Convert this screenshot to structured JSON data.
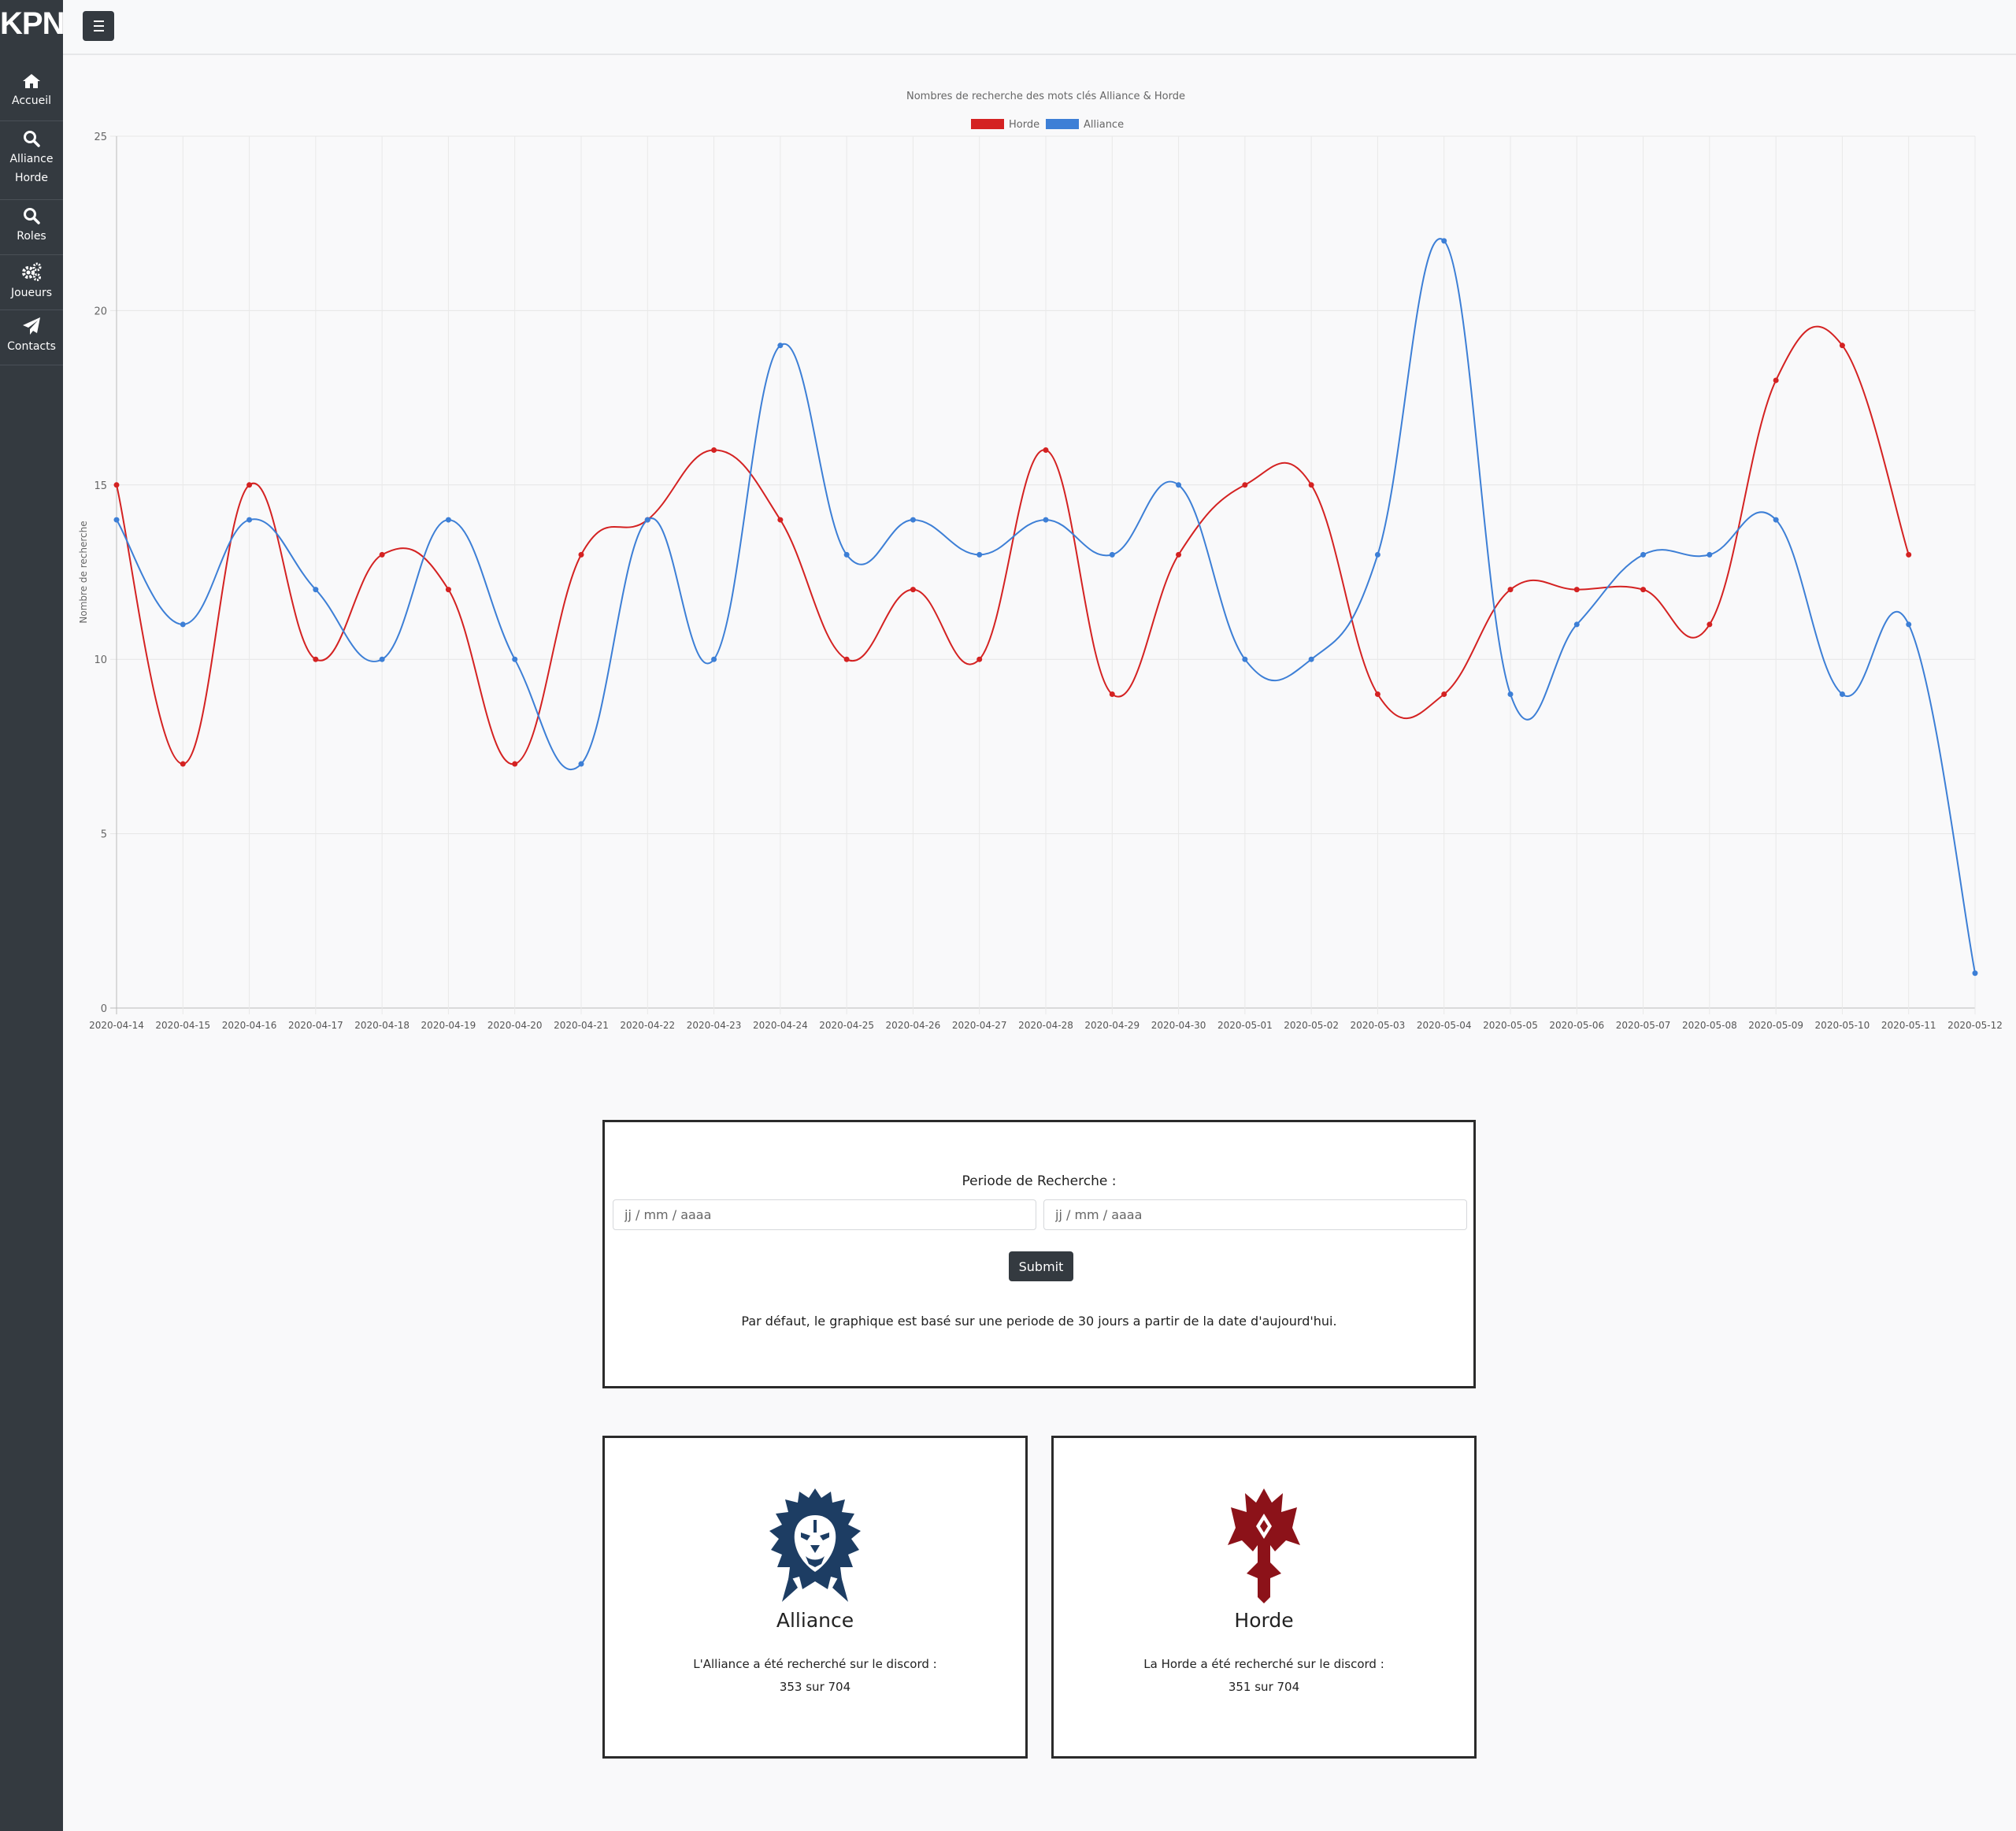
{
  "brand": "KPN",
  "sidebar": {
    "items": [
      {
        "icon": "home-icon",
        "label": "Accueil"
      },
      {
        "icon": "search-icon",
        "label": "Alliance Horde"
      },
      {
        "icon": "search-icon",
        "label": "Roles"
      },
      {
        "icon": "gears-icon",
        "label": "Joueurs"
      },
      {
        "icon": "paper-plane-icon",
        "label": "Contacts"
      }
    ]
  },
  "topbar": {
    "menu_icon": "hamburger-icon"
  },
  "chart_data": {
    "type": "line",
    "title": "Nombres de recherche des mots clés Alliance & Horde",
    "ylabel": "Nombre de recherche",
    "xlabel": "",
    "ylim": [
      0,
      25
    ],
    "yticks": [
      0,
      5,
      10,
      15,
      20,
      25
    ],
    "grid": true,
    "legend_position": "top",
    "categories": [
      "2020-04-14",
      "2020-04-15",
      "2020-04-16",
      "2020-04-17",
      "2020-04-18",
      "2020-04-19",
      "2020-04-20",
      "2020-04-21",
      "2020-04-22",
      "2020-04-23",
      "2020-04-24",
      "2020-04-25",
      "2020-04-26",
      "2020-04-27",
      "2020-04-28",
      "2020-04-29",
      "2020-04-30",
      "2020-05-01",
      "2020-05-02",
      "2020-05-03",
      "2020-05-04",
      "2020-05-05",
      "2020-05-06",
      "2020-05-07",
      "2020-05-08",
      "2020-05-09",
      "2020-05-10",
      "2020-05-11",
      "2020-05-12"
    ],
    "series": [
      {
        "name": "Horde",
        "color": "#d42222",
        "values": [
          15,
          7,
          15,
          10,
          13,
          12,
          7,
          13,
          14,
          16,
          14,
          10,
          12,
          10,
          16,
          9,
          13,
          15,
          15,
          9,
          9,
          12,
          12,
          12,
          11,
          18,
          19,
          13,
          null
        ]
      },
      {
        "name": "Alliance",
        "color": "#3d7fd6",
        "values": [
          14,
          11,
          14,
          12,
          10,
          14,
          10,
          7,
          14,
          10,
          19,
          13,
          14,
          13,
          14,
          13,
          15,
          10,
          10,
          13,
          22,
          9,
          11,
          13,
          13,
          14,
          9,
          11,
          1
        ]
      }
    ]
  },
  "period_form": {
    "label": "Periode de Recherche :",
    "start_placeholder": "jj / mm / aaaa",
    "end_placeholder": "jj / mm / aaaa",
    "submit_label": "Submit",
    "note": "Par défaut, le graphique est basé sur une periode de 30 jours a partir de la date d'aujourd'hui."
  },
  "factions": {
    "alliance": {
      "name": "Alliance",
      "text": "L'Alliance a été recherché sur le discord :",
      "count": "353 sur 704",
      "color": "#1d3d63"
    },
    "horde": {
      "name": "Horde",
      "text": "La Horde a été recherché sur le discord :",
      "count": "351 sur 704",
      "color": "#8c1219"
    }
  }
}
